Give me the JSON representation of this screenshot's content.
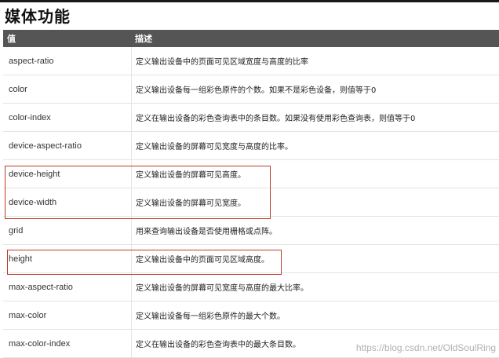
{
  "title": "媒体功能",
  "table": {
    "headers": [
      "值",
      "描述"
    ],
    "rows": [
      {
        "value": "aspect-ratio",
        "desc": "定义输出设备中的页面可见区域宽度与高度的比率"
      },
      {
        "value": "color",
        "desc": "定义输出设备每一组彩色原件的个数。如果不是彩色设备，则值等于0"
      },
      {
        "value": "color-index",
        "desc": "定义在输出设备的彩色查询表中的条目数。如果没有使用彩色查询表，则值等于0"
      },
      {
        "value": "device-aspect-ratio",
        "desc": "定义输出设备的屏幕可见宽度与高度的比率。"
      },
      {
        "value": "device-height",
        "desc": "定义输出设备的屏幕可见高度。"
      },
      {
        "value": "device-width",
        "desc": "定义输出设备的屏幕可见宽度。"
      },
      {
        "value": "grid",
        "desc": "用来查询输出设备是否使用栅格或点阵。"
      },
      {
        "value": "height",
        "desc": "定义输出设备中的页面可见区域高度。"
      },
      {
        "value": "max-aspect-ratio",
        "desc": "定义输出设备的屏幕可见宽度与高度的最大比率。"
      },
      {
        "value": "max-color",
        "desc": "定义输出设备每一组彩色原件的最大个数。"
      },
      {
        "value": "max-color-index",
        "desc": "定义在输出设备的彩色查询表中的最大条目数。"
      }
    ]
  },
  "watermark": "https://blog.csdn.net/OldSoulRing"
}
